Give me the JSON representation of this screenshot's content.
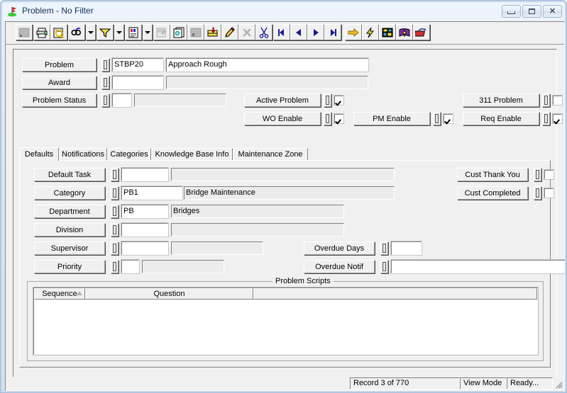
{
  "window": {
    "title": "Problem - No Filter",
    "icon": "flag-marker-icon",
    "buttons": {
      "minimize": "Minimize",
      "maximize": "Maximize",
      "close": "Close"
    }
  },
  "toolbar": {
    "items": [
      {
        "name": "select-all-icon",
        "label": "Select",
        "type": "button",
        "disabled": true
      },
      {
        "name": "print-icon",
        "label": "Print",
        "type": "button"
      },
      {
        "name": "print-preview-icon",
        "label": "Print Preview",
        "type": "button"
      },
      {
        "name": "find-icon",
        "label": "Find",
        "type": "button"
      },
      {
        "name": "find-dropdown-icon",
        "label": "Find Options",
        "type": "arrow"
      },
      {
        "name": "filter-icon",
        "label": "Filter",
        "type": "button"
      },
      {
        "name": "filter-dropdown-icon",
        "label": "Filter Options",
        "type": "arrow"
      },
      {
        "name": "report-icon",
        "label": "Report",
        "type": "button"
      },
      {
        "name": "report-dropdown-icon",
        "label": "Report Options",
        "type": "arrow"
      },
      {
        "name": "form-design-icon",
        "label": "Form Design",
        "type": "button",
        "disabled": true
      },
      {
        "name": "copy-record-icon",
        "label": "Copy Record",
        "type": "button"
      },
      {
        "name": "save-icon",
        "label": "Save",
        "type": "button",
        "disabled": true
      },
      {
        "name": "add-record-icon",
        "label": "Add Record",
        "type": "button"
      },
      {
        "name": "edit-record-icon",
        "label": "Edit Record",
        "type": "button"
      },
      {
        "name": "delete-record-icon",
        "label": "Delete Record",
        "type": "button",
        "disabled": true
      },
      {
        "name": "cut-icon",
        "label": "Cut",
        "type": "button"
      },
      {
        "name": "first-record-icon",
        "label": "First Record",
        "type": "button"
      },
      {
        "name": "previous-record-icon",
        "label": "Previous Record",
        "type": "button"
      },
      {
        "name": "next-record-icon",
        "label": "Next Record",
        "type": "button"
      },
      {
        "name": "last-record-icon",
        "label": "Last Record",
        "type": "button"
      },
      {
        "name": "go-to-icon",
        "label": "Go To",
        "type": "button"
      },
      {
        "name": "quick-action-icon",
        "label": "Quick Action",
        "type": "button"
      },
      {
        "name": "layout-icon",
        "label": "Layout",
        "type": "button"
      },
      {
        "name": "help-book-icon",
        "label": "Help",
        "type": "button"
      },
      {
        "name": "exit-icon",
        "label": "Exit",
        "type": "button"
      }
    ]
  },
  "header": {
    "rows": [
      {
        "name": "problem",
        "label": "Problem",
        "code": "STBP20",
        "description": "Approach Rough"
      },
      {
        "name": "award",
        "label": "Award",
        "code": "",
        "description": ""
      },
      {
        "name": "problem-status",
        "label": "Problem Status",
        "code": "",
        "description": ""
      }
    ],
    "flags": [
      {
        "name": "active-problem",
        "label": "Active Problem",
        "checked": true
      },
      {
        "name": "wo-enable",
        "label": "WO Enable",
        "checked": true
      },
      {
        "name": "pm-enable",
        "label": "PM Enable",
        "checked": true
      },
      {
        "name": "311-problem",
        "label": "311 Problem",
        "checked": false
      },
      {
        "name": "req-enable",
        "label": "Req Enable",
        "checked": true
      }
    ]
  },
  "tabs": [
    {
      "label": "Defaults",
      "active": true
    },
    {
      "label": "Notifications",
      "active": false
    },
    {
      "label": "Categories",
      "active": false
    },
    {
      "label": "Knowledge Base Info",
      "active": false
    },
    {
      "label": "Maintenance Zone",
      "active": false
    }
  ],
  "defaults_tab": {
    "rows": [
      {
        "name": "default-task",
        "label": "Default Task",
        "code": "",
        "description": ""
      },
      {
        "name": "category",
        "label": "Category",
        "code": "PB1",
        "description": "Bridge Maintenance"
      },
      {
        "name": "department",
        "label": "Department",
        "code": "PB",
        "description": "Bridges"
      },
      {
        "name": "division",
        "label": "Division",
        "code": "",
        "description": ""
      },
      {
        "name": "supervisor",
        "label": "Supervisor",
        "code": "",
        "description": ""
      },
      {
        "name": "priority",
        "label": "Priority",
        "code": "",
        "description": ""
      }
    ],
    "overdue": [
      {
        "name": "overdue-days",
        "label": "Overdue Days",
        "value": ""
      },
      {
        "name": "overdue-notif",
        "label": "Overdue Notif",
        "value": ""
      }
    ],
    "cust_flags": [
      {
        "name": "cust-thank-you",
        "label": "Cust Thank You",
        "checked": false
      },
      {
        "name": "cust-completed",
        "label": "Cust Completed",
        "checked": false
      }
    ],
    "scripts": {
      "title": "Problem Scripts",
      "columns": [
        "Sequence",
        "Question",
        ""
      ],
      "sort_column": "Sequence",
      "rows": []
    }
  },
  "statusbar": {
    "record": "Record 3 of 770",
    "mode": "View Mode",
    "state": "Ready..."
  }
}
